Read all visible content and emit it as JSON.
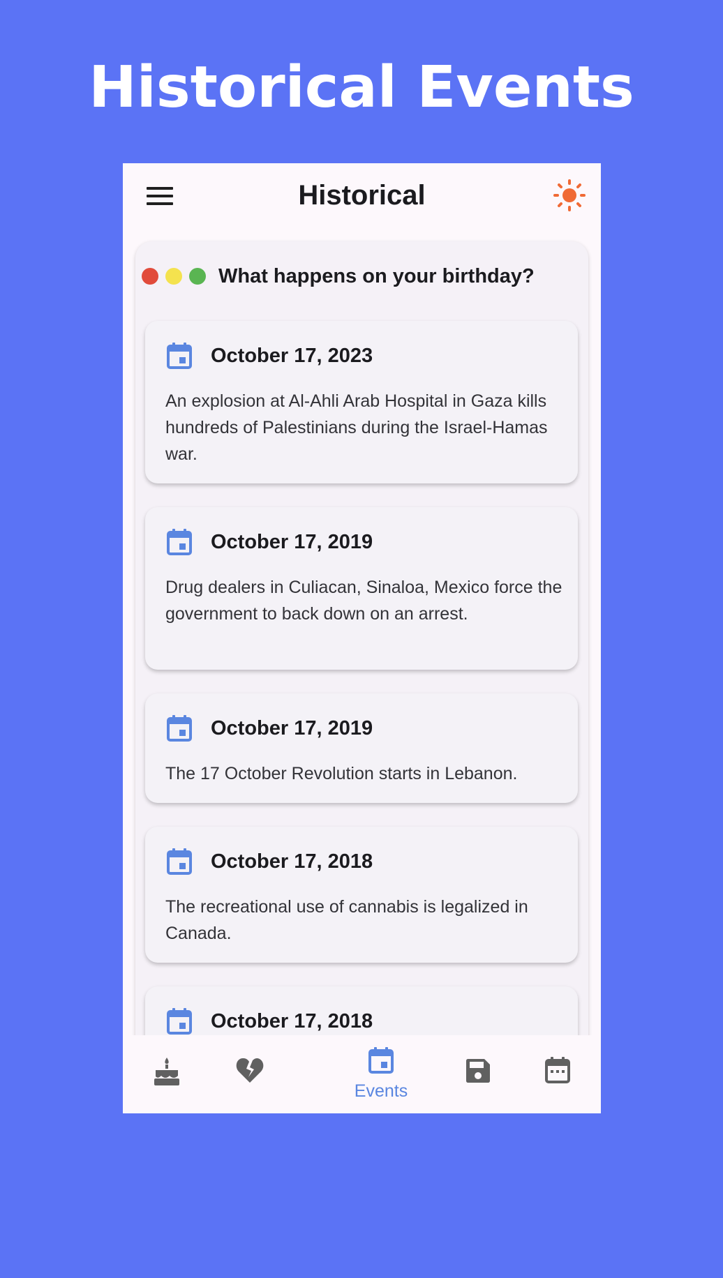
{
  "promo": {
    "title": "Historical Events"
  },
  "app": {
    "title": "Historical",
    "colors": {
      "accent": "#5a86e0",
      "sun": "#f06a35",
      "background": "#5b73f5"
    }
  },
  "card": {
    "heading": "What happens on your birthday?",
    "dots": [
      "#e14b3b",
      "#f4e24e",
      "#5ab552"
    ]
  },
  "events": [
    {
      "date": "October 17, 2023",
      "description": "An explosion at Al-Ahli Arab Hospital in Gaza kills hundreds of Palestinians during the Israel-Hamas war."
    },
    {
      "date": "October 17, 2019",
      "description": "Drug dealers in Culiacan, Sinaloa, Mexico force the government to back down on an arrest."
    },
    {
      "date": "October 17, 2019",
      "description": "The 17 October Revolution starts in Lebanon."
    },
    {
      "date": "October 17, 2018",
      "description": "The recreational use of cannabis is legalized in Canada."
    },
    {
      "date": "October 17, 2018",
      "description": ""
    }
  ],
  "nav": {
    "items": [
      {
        "icon": "cake-icon",
        "label": ""
      },
      {
        "icon": "broken-heart-icon",
        "label": ""
      },
      {
        "icon": "calendar-event-icon",
        "label": "Events",
        "active": true
      },
      {
        "icon": "save-icon",
        "label": ""
      },
      {
        "icon": "calendar-month-icon",
        "label": ""
      }
    ]
  }
}
